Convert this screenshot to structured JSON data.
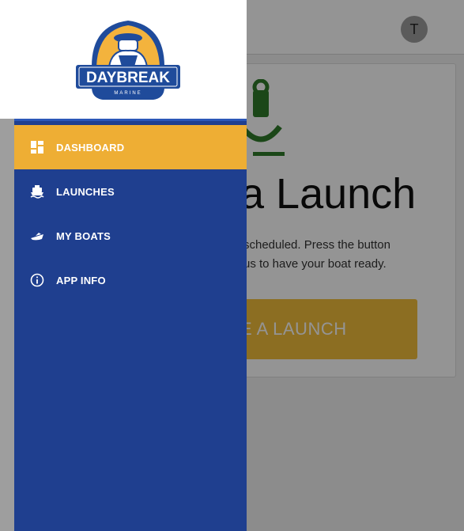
{
  "header": {
    "avatar_initial": "T"
  },
  "main": {
    "title": "a Launch",
    "description_line1": "scheduled. Press the button",
    "description_line2": "us to have your boat ready.",
    "button_label": "E A LAUNCH"
  },
  "drawer": {
    "logo": {
      "name": "DAYBREAK",
      "sub": "MARINE"
    },
    "items": [
      {
        "label": "DASHBOARD",
        "icon": "dashboard-icon",
        "active": true
      },
      {
        "label": "LAUNCHES",
        "icon": "boat-icon",
        "active": false
      },
      {
        "label": "MY BOATS",
        "icon": "speedboat-icon",
        "active": false
      },
      {
        "label": "APP INFO",
        "icon": "info-icon",
        "active": false
      }
    ]
  },
  "colors": {
    "accent": "#eeae34",
    "drawer_bg": "#1f3f8f",
    "logo_blue": "#1f4b9b"
  }
}
